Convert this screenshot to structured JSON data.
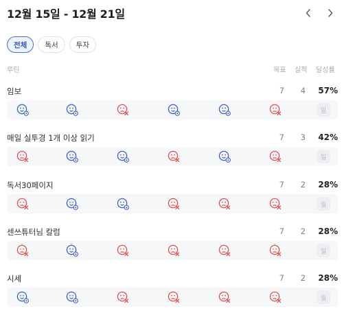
{
  "header": {
    "date_range": "12월 15일 - 12월 21일"
  },
  "tabs": [
    {
      "label": "전체",
      "active": true
    },
    {
      "label": "독서",
      "active": false
    },
    {
      "label": "투자",
      "active": false
    }
  ],
  "columns": {
    "routine": "루틴",
    "goal": "목표",
    "actual": "실적",
    "rate": "달성률"
  },
  "colors": {
    "done": "#3a5ccc",
    "missed": "#e24d4d",
    "accent": "#3f6fd8"
  },
  "routines": [
    {
      "name": "임보",
      "goal": "7",
      "actual": "4",
      "rate": "57%",
      "days": [
        "done",
        "done",
        "missed",
        "done",
        "done",
        "missed",
        "empty"
      ],
      "last_day_label": "일"
    },
    {
      "name": "매일 실투경 1개 이상 읽기",
      "goal": "7",
      "actual": "3",
      "rate": "42%",
      "days": [
        "missed",
        "done",
        "done",
        "missed",
        "done",
        "missed",
        "empty"
      ],
      "last_day_label": "일"
    },
    {
      "name": "독서30페이지",
      "goal": "7",
      "actual": "2",
      "rate": "28%",
      "days": [
        "missed",
        "done",
        "done",
        "missed",
        "missed",
        "missed",
        "empty"
      ],
      "last_day_label": "일"
    },
    {
      "name": "센쓰튜터님 칼럼",
      "goal": "7",
      "actual": "2",
      "rate": "28%",
      "days": [
        "missed",
        "done",
        "missed",
        "missed",
        "missed",
        "missed",
        "empty"
      ],
      "last_day_label": "일"
    },
    {
      "name": "시세",
      "goal": "7",
      "actual": "2",
      "rate": "28%",
      "days": [
        "done",
        "done",
        "missed",
        "missed",
        "missed",
        "missed",
        "empty"
      ],
      "last_day_label": "일"
    }
  ]
}
